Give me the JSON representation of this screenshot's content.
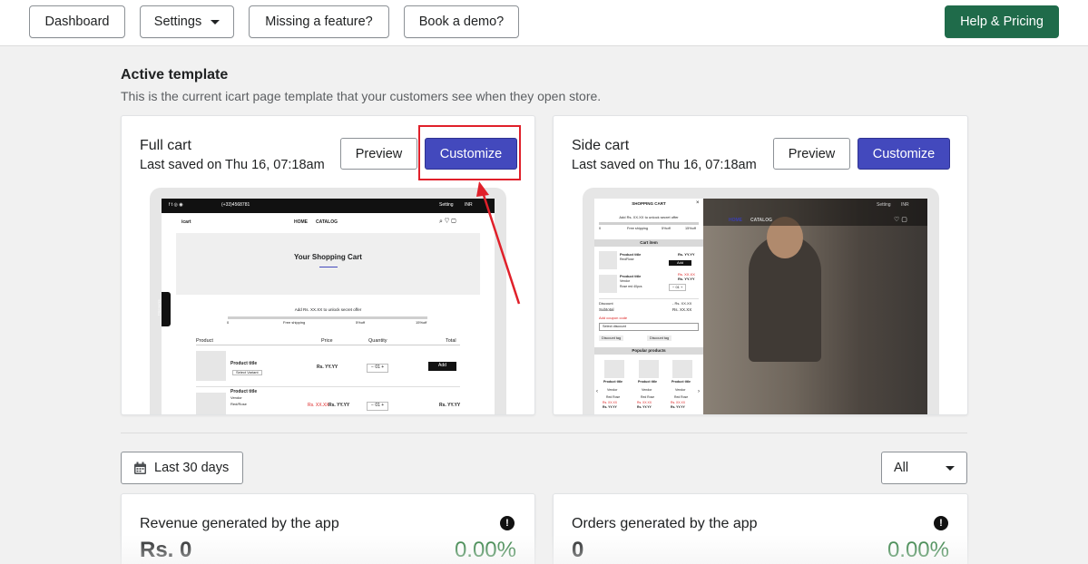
{
  "topbar": {
    "dashboard": "Dashboard",
    "settings": "Settings",
    "missing_feature": "Missing a feature?",
    "book_demo": "Book a demo?",
    "help_pricing": "Help & Pricing"
  },
  "active_template": {
    "title": "Active template",
    "description": "This is the current icart page template that your customers see when they open store."
  },
  "templates": [
    {
      "name": "Full cart",
      "saved": "Last saved on Thu 16, 07:18am",
      "preview_label": "Preview",
      "customize_label": "Customize"
    },
    {
      "name": "Side cart",
      "saved": "Last saved on Thu 16, 07:18am",
      "preview_label": "Preview",
      "customize_label": "Customize"
    }
  ],
  "full_preview": {
    "phone": "(+33)4568781",
    "setting": "Setting",
    "currency": "INR",
    "logo": "icart",
    "nav": [
      "HOME",
      "CATALOG"
    ],
    "heading": "Your Shopping Cart",
    "offer": "Add Rs. XX.XX to unlock secret offer",
    "progress_labels": [
      "0",
      "Free shipping",
      "5%off",
      "15%off"
    ],
    "columns": [
      "Product",
      "Price",
      "Quantity",
      "Total"
    ],
    "row1": {
      "title": "Product title",
      "variant": "Select Variant",
      "price": "Rs. YY.YY",
      "qty": "01",
      "action": "Add"
    },
    "row2": {
      "title": "Product title",
      "vendor": "Vendor",
      "variant": "Red/Rose",
      "compare": "Rs. XX.XX",
      "price": "Rs. YY.YY",
      "qty": "01",
      "total": "Rs. YY.YY"
    },
    "side_tab": "Discounts"
  },
  "side_preview": {
    "header": "SHOPPING CART",
    "offer": "Add Rs. XX.XX to unlock secret offer",
    "progress_labels": [
      "0",
      "Free shipping",
      "5%off",
      "15%off"
    ],
    "cart_item": "Cart item",
    "item1": {
      "title": "Product title",
      "variant": "Red/Rose",
      "price": "Rs. YY.YY",
      "action": "Add"
    },
    "item2": {
      "title": "Product title",
      "vendor": "Vendor",
      "variant": "Rose red 40pcs",
      "compare": "Rs. XX.XX",
      "price": "Rs. YY.YY",
      "qty": "01"
    },
    "discount_label": "Discount",
    "discount_value": "- Rs. XX.XX",
    "subtotal_label": "Subtotal",
    "subtotal_value": "Rs. XX.XX",
    "add_coupon": "Add coupon code",
    "coupon_placeholder": "Select discount",
    "tags": [
      "Discount tag",
      "Discount tag"
    ],
    "popular": "Popular products",
    "products": [
      {
        "title": "Product title",
        "vendor": "Vendor",
        "variant": "Red Rose",
        "compare": "Rs. XX.XX",
        "price": "Rs. YY.YY"
      },
      {
        "title": "Product title",
        "vendor": "Vendor",
        "variant": "Red Rose",
        "compare": "Rs. XX.XX",
        "price": "Rs. YY.YY"
      },
      {
        "title": "Product title",
        "vendor": "Vendor",
        "variant": "Red Rose",
        "compare": "Rs. XX.XX",
        "price": "Rs. YY.YY"
      }
    ],
    "nav": [
      "HOME",
      "CATALOG"
    ],
    "setting": "Setting",
    "currency": "INR"
  },
  "filters": {
    "date_range": "Last 30 days",
    "select_value": "All"
  },
  "stats": [
    {
      "title": "Revenue generated by the app",
      "value": "Rs. 0",
      "pct": "0.00%"
    },
    {
      "title": "Orders generated by the app",
      "value": "0",
      "pct": "0.00%"
    }
  ],
  "colors": {
    "accent": "#4349bd",
    "primary_green": "#1f6b4a",
    "positive": "#2e7d3e",
    "annotation_red": "#e0202a"
  }
}
